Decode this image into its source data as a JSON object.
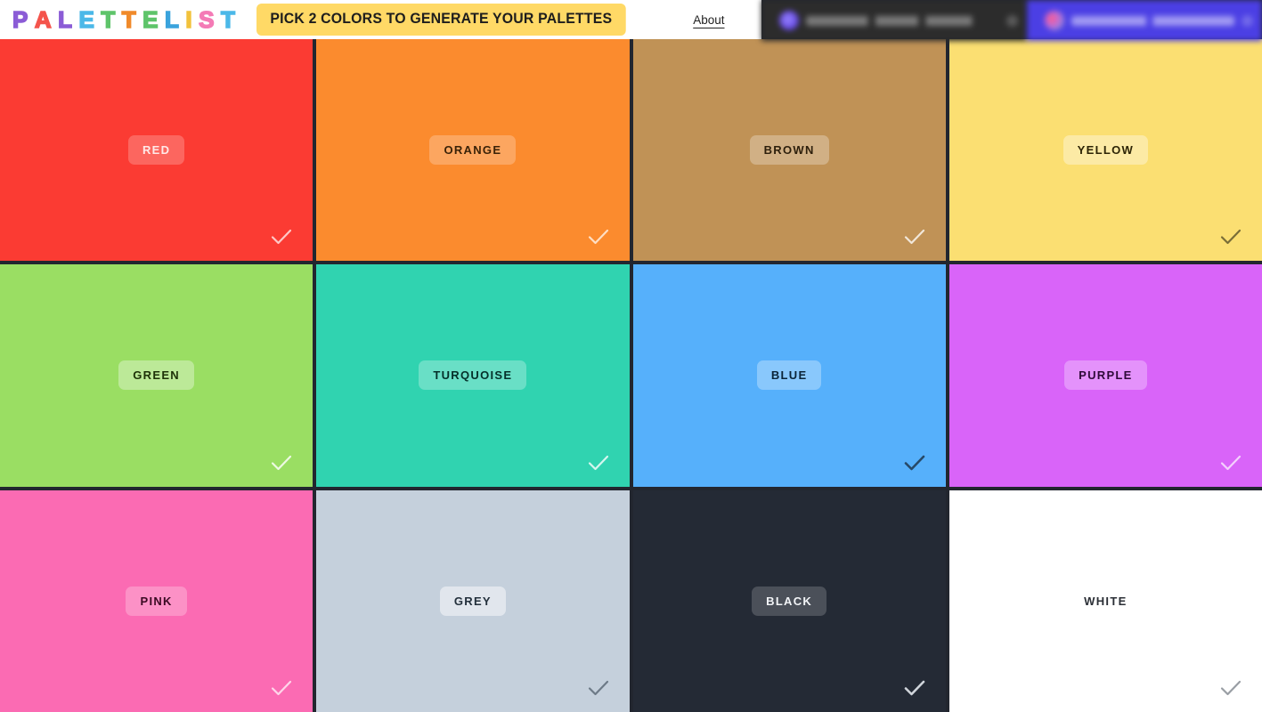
{
  "header": {
    "logo_letters": [
      {
        "char": "P",
        "color": "#8b5cd6"
      },
      {
        "char": "A",
        "color": "#f4544c"
      },
      {
        "char": "L",
        "color": "#8b5cd6"
      },
      {
        "char": "E",
        "color": "#4bb8e8"
      },
      {
        "char": "T",
        "color": "#5ec46a"
      },
      {
        "char": "T",
        "color": "#f08a2a"
      },
      {
        "char": "E",
        "color": "#5ec46a"
      },
      {
        "char": "L",
        "color": "#3aa3dd"
      },
      {
        "char": "I",
        "color": "#f2c23c"
      },
      {
        "char": "S",
        "color": "#f47bb6"
      },
      {
        "char": "T",
        "color": "#4bb8e8"
      }
    ],
    "banner_text": "PICK 2 COLORS TO GENERATE YOUR PALETTES",
    "banner_bg": "#ffd966",
    "about_label": "About"
  },
  "browser": {
    "tabs": [
      {
        "title": "",
        "active": false,
        "close_icon": "close-icon"
      },
      {
        "title": "",
        "active": true,
        "close_icon": "close-icon"
      }
    ]
  },
  "grid": {
    "background": "#22262f",
    "selected_count": 2,
    "swatches": [
      {
        "name": "RED",
        "bg": "#fb3b33",
        "label_bg": "rgba(255,255,255,0.22)",
        "label_color": "#ffe9e8",
        "check_color": "rgba(255,255,255,0.72)",
        "selected": false
      },
      {
        "name": "ORANGE",
        "bg": "#fb8b2e",
        "label_bg": "rgba(255,255,255,0.24)",
        "label_color": "#3a2208",
        "check_color": "rgba(255,255,255,0.72)",
        "selected": false
      },
      {
        "name": "BROWN",
        "bg": "#c09256",
        "label_bg": "rgba(255,255,255,0.28)",
        "label_color": "#2d1f0c",
        "check_color": "rgba(255,255,255,0.78)",
        "selected": false
      },
      {
        "name": "YELLOW",
        "bg": "#fbdf72",
        "label_bg": "rgba(255,255,255,0.36)",
        "label_color": "#2d2405",
        "check_color": "rgba(40,38,20,0.62)",
        "selected": false
      },
      {
        "name": "GREEN",
        "bg": "#9ade63",
        "label_bg": "rgba(255,255,255,0.34)",
        "label_color": "#1e3208",
        "check_color": "rgba(255,255,255,0.82)",
        "selected": false
      },
      {
        "name": "TURQUOISE",
        "bg": "#30d3b0",
        "label_bg": "rgba(255,255,255,0.28)",
        "label_color": "#05302a",
        "check_color": "rgba(255,255,255,0.80)",
        "selected": false
      },
      {
        "name": "BLUE",
        "bg": "#56b0fb",
        "label_bg": "rgba(255,255,255,0.30)",
        "label_color": "#0b2438",
        "check_color": "rgba(26,44,62,0.78)",
        "selected": true
      },
      {
        "name": "PURPLE",
        "bg": "#d964f9",
        "label_bg": "rgba(255,255,255,0.30)",
        "label_color": "#2e0a38",
        "check_color": "rgba(255,255,255,0.70)",
        "selected": false
      },
      {
        "name": "PINK",
        "bg": "#fb6bb3",
        "label_bg": "rgba(255,255,255,0.26)",
        "label_color": "#3a0a22",
        "check_color": "rgba(255,255,255,0.72)",
        "selected": false
      },
      {
        "name": "GREY",
        "bg": "#c5d0dc",
        "label_bg": "rgba(255,255,255,0.48)",
        "label_color": "#23303c",
        "check_color": "rgba(45,60,74,0.58)",
        "selected": false
      },
      {
        "name": "BLACK",
        "bg": "#242a35",
        "label_bg": "rgba(255,255,255,0.18)",
        "label_color": "#f2f4f7",
        "check_color": "rgba(235,240,246,0.86)",
        "selected": true
      },
      {
        "name": "WHITE",
        "bg": "#ffffff",
        "label_bg": "rgba(255,255,255,0.0)",
        "label_color": "#2b2f36",
        "check_color": "rgba(70,78,90,0.55)",
        "selected": false
      }
    ]
  },
  "icons": {
    "check": "check-icon",
    "close": "close-icon"
  }
}
